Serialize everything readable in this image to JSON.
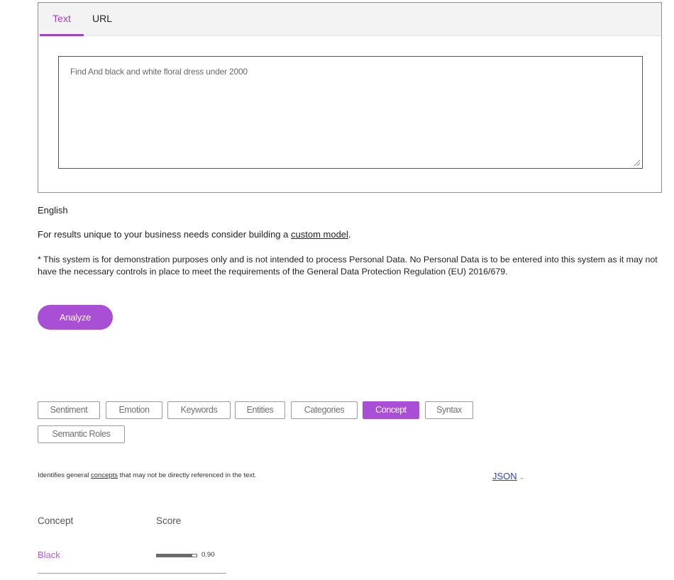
{
  "input_tabs": [
    {
      "label": "Text",
      "active": true
    },
    {
      "label": "URL",
      "active": false
    }
  ],
  "textarea": {
    "value": "Find And black and white floral dress under 2000"
  },
  "language": "English",
  "custom_note": {
    "prefix": "For results unique to your business needs consider building a ",
    "link": "custom model",
    "suffix": "."
  },
  "disclaimer": "* This system is for demonstration purposes only and is not intended to process Personal Data. No Personal Data is to be entered into this system as it may not have the necessary controls in place to meet the requirements of the General Data Protection Regulation (EU) 2016/679.",
  "analyze_label": "Analyze",
  "feature_tabs": [
    {
      "label": "Sentiment",
      "active": false
    },
    {
      "label": "Emotion",
      "active": false
    },
    {
      "label": "Keywords",
      "active": false
    },
    {
      "label": "Entities",
      "active": false
    },
    {
      "label": "Categories",
      "active": false
    },
    {
      "label": "Concept",
      "active": true
    },
    {
      "label": "Syntax",
      "active": false
    },
    {
      "label": "Semantic Roles",
      "active": false
    }
  ],
  "description": {
    "prefix": "Identifies general ",
    "link": "concepts",
    "suffix": " that may not be directly referenced in the text."
  },
  "json_link": {
    "label": "JSON",
    "icon": "chevron-down-icon"
  },
  "results": {
    "headers": {
      "concept": "Concept",
      "score": "Score"
    },
    "rows": [
      {
        "concept": "Black",
        "score": 0.9,
        "score_label": "0.90"
      }
    ]
  },
  "colors": {
    "accent": "#a84fd6",
    "concept_text": "#b45ed8",
    "link_blue": "#2f3fc4"
  }
}
